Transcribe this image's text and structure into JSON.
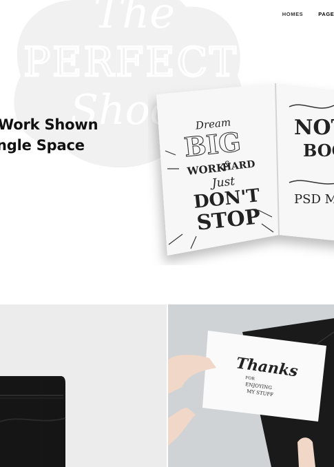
{
  "nav": {
    "items": [
      {
        "label": "HOMES"
      },
      {
        "label": "PAGES"
      }
    ]
  },
  "hero": {
    "headline_line1": "Work Shown",
    "headline_line2": "ngle Space",
    "logo_watermark": {
      "line1": "The",
      "line2": "PERFECT",
      "line3": "Shoot"
    }
  },
  "notebook": {
    "left_page": {
      "dream": "Dream",
      "big": "BIG",
      "work": "WORK",
      "and": "&",
      "hard": "HARD",
      "just": "Just",
      "dont": "DON'T",
      "stop": "STOP"
    },
    "right_page": {
      "not": "NOT",
      "boo": "BOO",
      "psd": "PSD M"
    }
  },
  "tiles": [
    {
      "name": "black-pouch-mockup"
    },
    {
      "name": "thanks-card-mockup",
      "card_text_1": "Thanks",
      "card_text_2": "FOR",
      "card_text_3": "ENJOYING",
      "card_text_4": "MY STUFF"
    }
  ],
  "colors": {
    "background": "#ffffff",
    "text": "#111111",
    "watermark": "#efefef",
    "tile_left_bg": "#ececec",
    "tile_right_bg": "#cfd3d6"
  }
}
